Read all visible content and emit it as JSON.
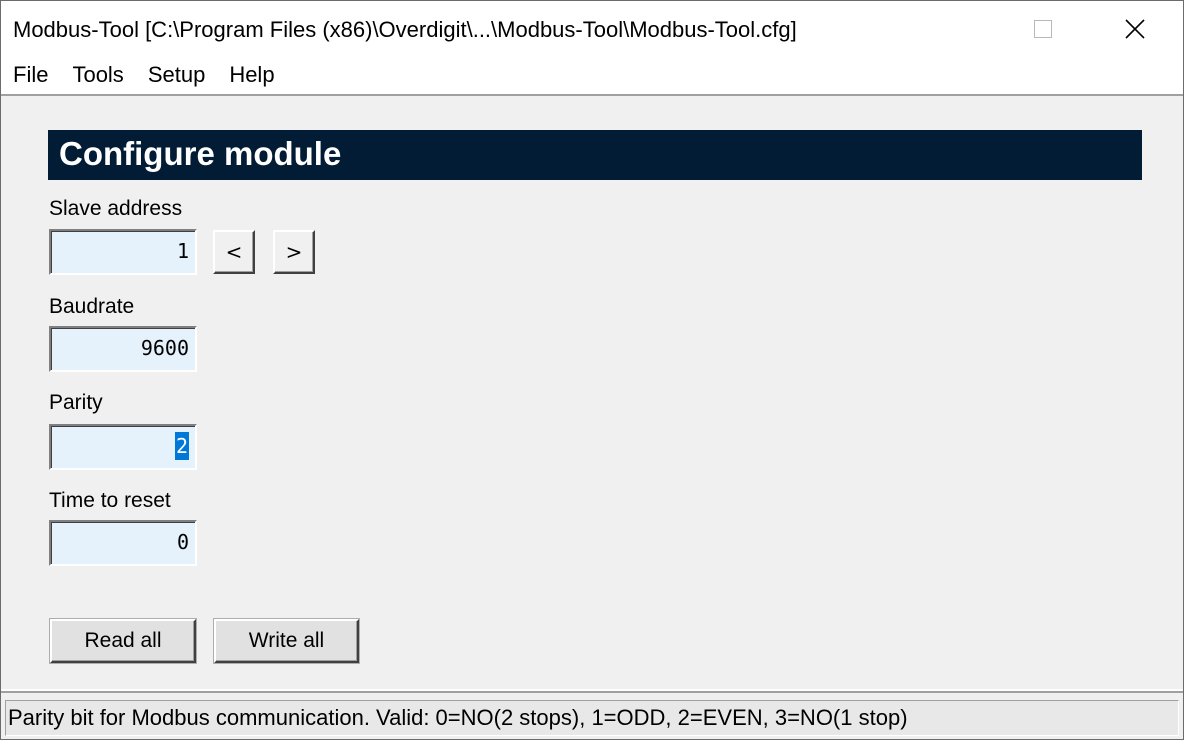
{
  "window": {
    "title": "Modbus-Tool [C:\\Program Files (x86)\\Overdigit\\...\\Modbus-Tool\\Modbus-Tool.cfg]",
    "close_glyph": "✕"
  },
  "menu": {
    "items": [
      {
        "label": "File"
      },
      {
        "label": "Tools"
      },
      {
        "label": "Setup"
      },
      {
        "label": "Help"
      }
    ]
  },
  "page": {
    "header_title": "Configure module"
  },
  "fields": {
    "slave_address": {
      "label": "Slave address",
      "value": "1"
    },
    "baudrate": {
      "label": "Baudrate",
      "value": "9600"
    },
    "parity": {
      "label": "Parity",
      "value": "2"
    },
    "time_to_reset": {
      "label": "Time to reset",
      "value": "0"
    }
  },
  "spin": {
    "prev_label": "<",
    "next_label": ">"
  },
  "buttons": {
    "read_all": "Read all",
    "write_all": "Write all"
  },
  "status": {
    "text": "Parity bit for Modbus communication. Valid: 0=NO(2 stops), 1=ODD, 2=EVEN, 3=NO(1 stop)"
  }
}
